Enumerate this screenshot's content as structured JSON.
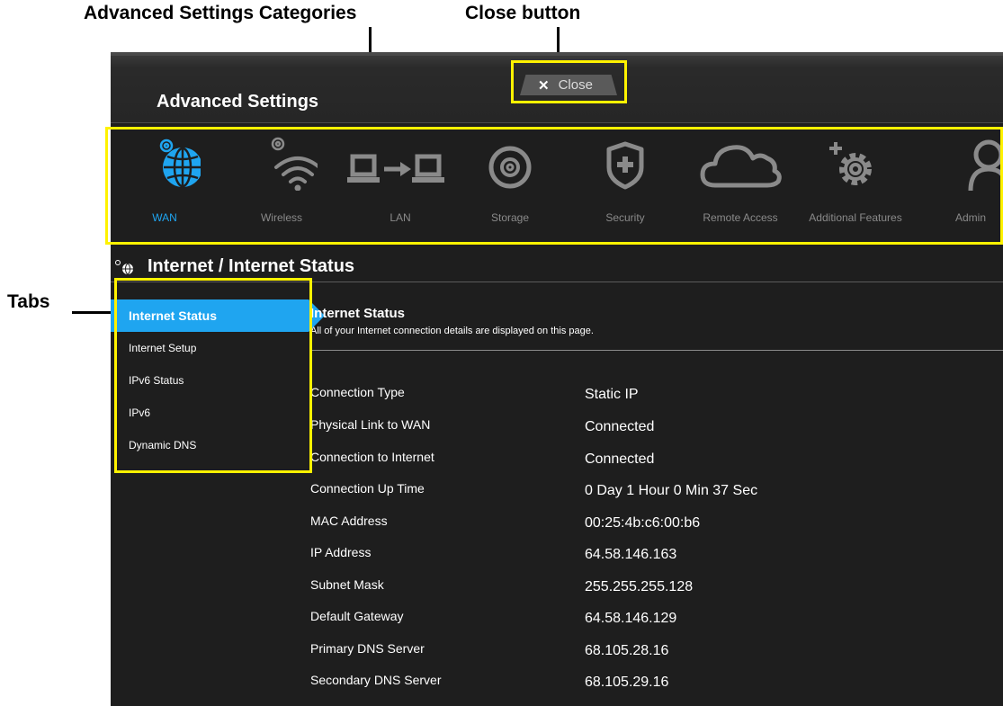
{
  "callouts": {
    "categories": "Advanced Settings Categories",
    "close": "Close button",
    "tabs": "Tabs"
  },
  "header": {
    "title": "Advanced Settings",
    "close_label": "Close"
  },
  "categories": [
    {
      "label": "WAN",
      "icon": "globe-icon",
      "active": true
    },
    {
      "label": "Wireless",
      "icon": "wifi-icon"
    },
    {
      "label": "LAN",
      "icon": "lan-computers-icon"
    },
    {
      "label": "Storage",
      "icon": "disk-icon"
    },
    {
      "label": "Security",
      "icon": "shield-icon"
    },
    {
      "label": "Remote Access",
      "icon": "cloud-icon"
    },
    {
      "label": "Additional Features",
      "icon": "gear-plus-icon"
    },
    {
      "label": "Admin",
      "icon": "user-icon"
    }
  ],
  "section": {
    "title": "Internet / Internet Status"
  },
  "tabs": [
    {
      "label": "Internet Status",
      "active": true
    },
    {
      "label": "Internet Setup"
    },
    {
      "label": "IPv6 Status"
    },
    {
      "label": "IPv6"
    },
    {
      "label": "Dynamic DNS"
    }
  ],
  "content": {
    "title": "Internet Status",
    "description": "All of your Internet connection details are displayed on this page.",
    "rows": [
      {
        "key": "Connection Type",
        "value": "Static IP"
      },
      {
        "key": "Physical Link to WAN",
        "value": "Connected"
      },
      {
        "key": "Connection to Internet",
        "value": "Connected"
      },
      {
        "key": "Connection Up Time",
        "value": "0 Day 1 Hour 0 Min 37 Sec"
      },
      {
        "key": "MAC Address",
        "value": "00:25:4b:c6:00:b6"
      },
      {
        "key": "IP Address",
        "value": "64.58.146.163"
      },
      {
        "key": "Subnet Mask",
        "value": "255.255.255.128"
      },
      {
        "key": "Default Gateway",
        "value": "64.58.146.129"
      },
      {
        "key": "Primary DNS Server",
        "value": "68.105.28.16"
      },
      {
        "key": "Secondary DNS Server",
        "value": "68.105.29.16"
      }
    ]
  },
  "colors": {
    "accent": "#1fa5f0",
    "annotation": "#fff200",
    "background": "#1e1e1e"
  }
}
